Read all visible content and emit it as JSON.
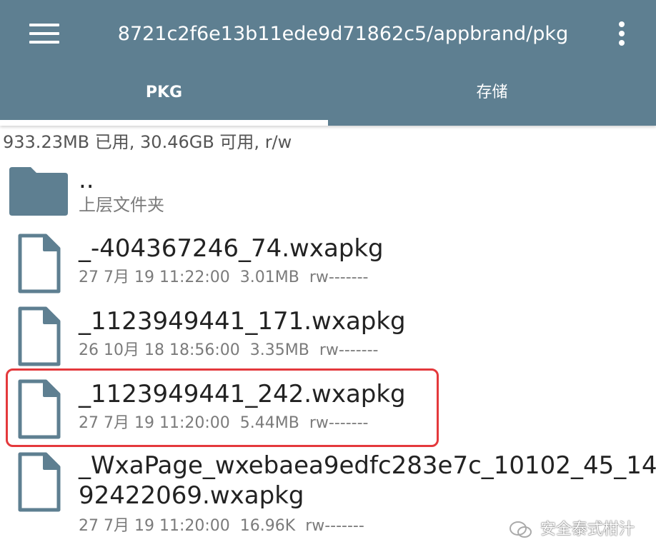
{
  "header": {
    "path": "8721c2f6e13b11ede9d71862c5/appbrand/pkg",
    "menu_icon": "hamburger-menu-icon",
    "more_icon": "overflow-more-icon"
  },
  "tabs": [
    {
      "label": "PKG",
      "active": true
    },
    {
      "label": "存储",
      "active": false
    }
  ],
  "storage_info": "933.23MB 已用, 30.46GB 可用, r/w",
  "parent_dir": {
    "name": "..",
    "subtitle": "上层文件夹",
    "icon": "folder-icon"
  },
  "files": [
    {
      "name": "_-404367246_74.wxapkg",
      "date": "27 7月 19 11:22:00",
      "size": "3.01MB",
      "perms": "rw-------"
    },
    {
      "name": "_1123949441_171.wxapkg",
      "date": "26 10月 18 18:56:00",
      "size": "3.35MB",
      "perms": "rw-------"
    },
    {
      "name": "_1123949441_242.wxapkg",
      "date": "27 7月 19 11:20:00",
      "size": "5.44MB",
      "perms": "rw-------",
      "highlighted": true
    },
    {
      "name_line1": "_WxaPage_wxebaea9edfc283e7c_10102_45_14",
      "name_line2": "92422069.wxapkg",
      "date": "27 7月 19 11:20:00",
      "size": "16.96K",
      "perms": "rw-------"
    }
  ],
  "watermark": "安全泰式柑汁",
  "colors": {
    "appbar": "#5e7f91",
    "icon": "#5e7f91",
    "highlight": "#e4393c"
  }
}
